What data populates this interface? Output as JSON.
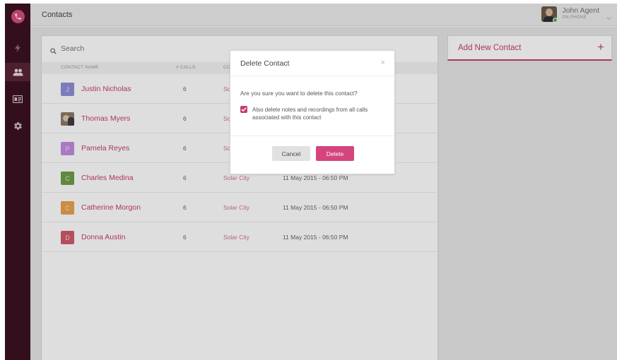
{
  "topbar": {
    "title": "Contacts",
    "user_name": "John Agent",
    "user_status": "ON PHONE"
  },
  "search": {
    "placeholder": "Search"
  },
  "table": {
    "headers": [
      "CONTACT NAME",
      "# CALLS",
      "CO"
    ],
    "rows": [
      {
        "initial": "J",
        "name": "Justin Nicholas",
        "calls": "6",
        "company": "So",
        "date": "",
        "color": "#8e8fd6"
      },
      {
        "initial": "",
        "name": "Thomas Myers",
        "calls": "6",
        "company": "So",
        "date": "",
        "color": ""
      },
      {
        "initial": "P",
        "name": "Pamela Reyes",
        "calls": "6",
        "company": "So",
        "date": "",
        "color": "#c48be0"
      },
      {
        "initial": "C",
        "name": "Charles Medina",
        "calls": "6",
        "company": "Solar City",
        "date": "11 May 2015 - 06:50 PM",
        "color": "#6f9e4a"
      },
      {
        "initial": "C",
        "name": "Catherine Morgon",
        "calls": "6",
        "company": "Solar City",
        "date": "11 May 2015 - 06:50 PM",
        "color": "#e8a24e"
      },
      {
        "initial": "D",
        "name": "Donna Austin",
        "calls": "6",
        "company": "Solar City",
        "date": "11 May 2015 - 06:50 PM",
        "color": "#cf5a6b"
      }
    ]
  },
  "add_panel": {
    "label": "Add New Contact",
    "plus": "+"
  },
  "modal": {
    "title": "Delete Contact",
    "close": "×",
    "message": "Are you sure you want to delete this contact?",
    "checkbox_label": "Also delete notes and recordings from all calls associated with this contact",
    "checkbox_checked": true,
    "cancel_label": "Cancel",
    "delete_label": "Delete"
  },
  "colors": {
    "accent": "#c43d73",
    "sidebar": "#3b1222"
  }
}
